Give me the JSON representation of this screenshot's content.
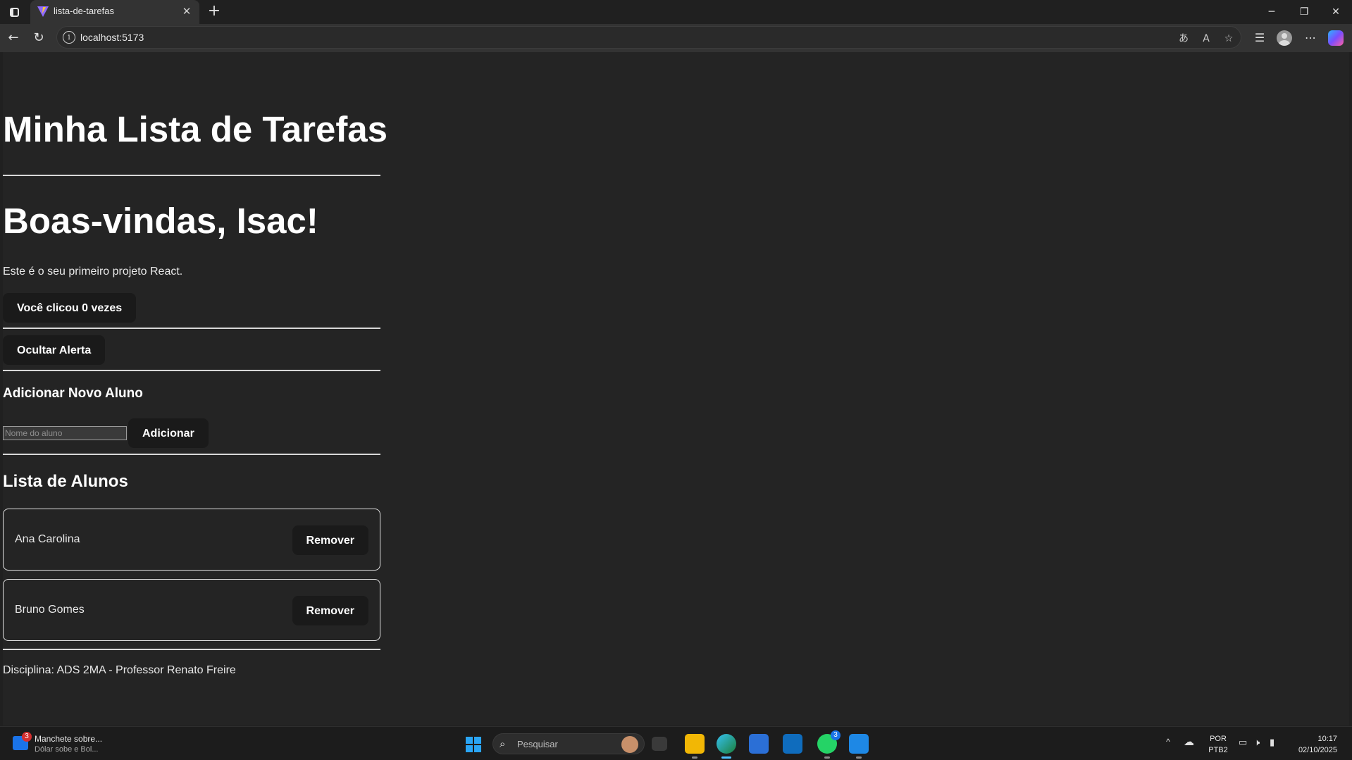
{
  "browser": {
    "tab_title": "lista-de-tarefas",
    "url": "localhost:5173"
  },
  "page": {
    "title": "Minha Lista de Tarefas",
    "welcome": "Boas-vindas, Isac!",
    "subtitle": "Este é o seu primeiro projeto React.",
    "counter_button": "Você clicou 0 vezes",
    "alert_button": "Ocultar Alerta",
    "add_section": {
      "heading": "Adicionar Novo Aluno",
      "input_placeholder": "Nome do aluno",
      "input_value": "",
      "add_button": "Adicionar"
    },
    "list_section": {
      "heading": "Lista de Alunos",
      "students": [
        {
          "name": "Ana Carolina",
          "remove_label": "Remover"
        },
        {
          "name": "Bruno Gomes",
          "remove_label": "Remover"
        }
      ]
    },
    "footer": "Disciplina: ADS 2MA - Professor Renato Freire"
  },
  "taskbar": {
    "news": {
      "badge": "3",
      "headline": "Manchete sobre...",
      "detail": "Dólar sobe e Bol..."
    },
    "search_placeholder": "Pesquisar",
    "whatsapp_badge": "3",
    "language": "POR",
    "keyboard": "PTB2",
    "time": "10:17",
    "date": "02/10/2025"
  }
}
